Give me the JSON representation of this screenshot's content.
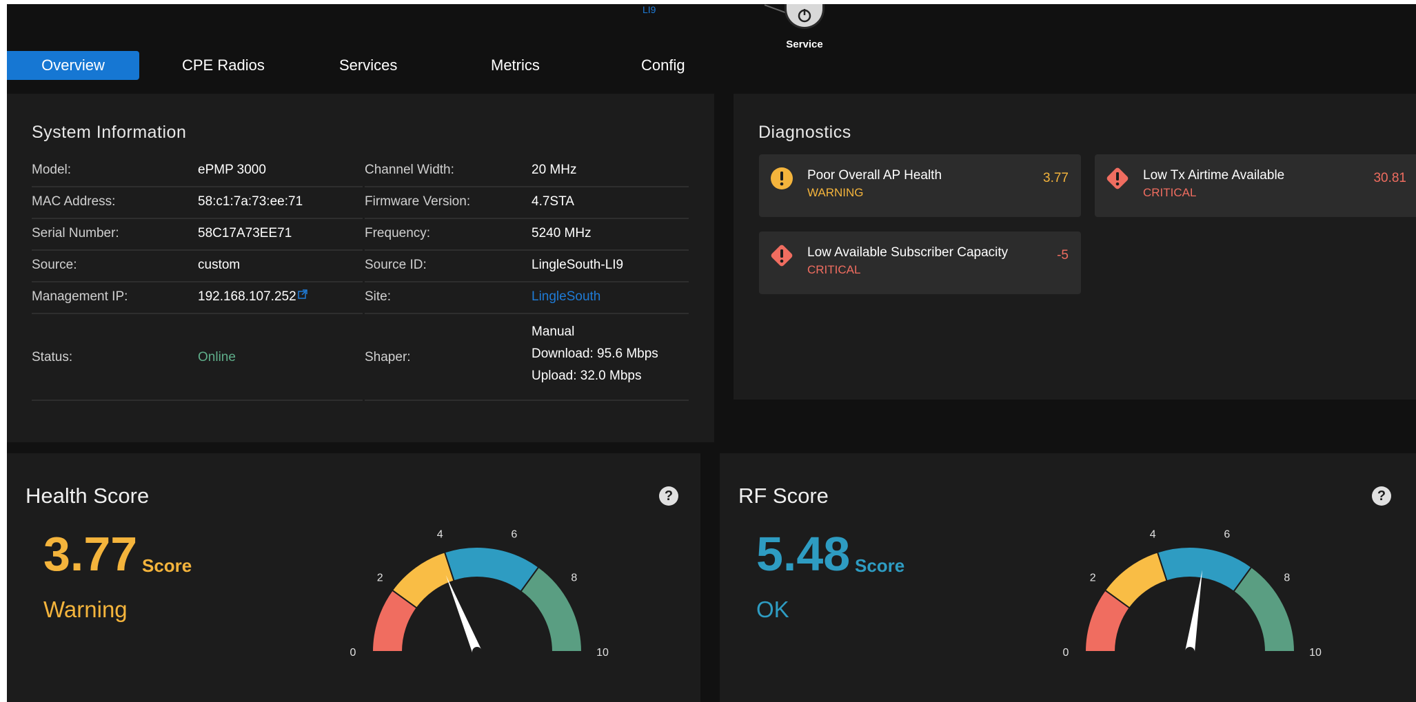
{
  "topology": {
    "link_label": "LI9",
    "node_label": "Service"
  },
  "tabs": [
    {
      "label": "Overview",
      "active": true
    },
    {
      "label": "CPE Radios"
    },
    {
      "label": "Services"
    },
    {
      "label": "Metrics"
    },
    {
      "label": "Config"
    }
  ],
  "system_info": {
    "title": "System Information",
    "left": [
      {
        "label": "Model:",
        "value": "ePMP 3000"
      },
      {
        "label": "MAC Address:",
        "value": "58:c1:7a:73:ee:71"
      },
      {
        "label": "Serial Number:",
        "value": "58C17A73EE71"
      },
      {
        "label": "Source:",
        "value": "custom"
      },
      {
        "label": "Management IP:",
        "value": "192.168.107.252"
      },
      {
        "label": "Status:",
        "value": "Online"
      }
    ],
    "right": [
      {
        "label": "Channel Width:",
        "value": "20 MHz"
      },
      {
        "label": "Firmware Version:",
        "value": "4.7STA"
      },
      {
        "label": "Frequency:",
        "value": "5240 MHz"
      },
      {
        "label": "Source ID:",
        "value": "LingleSouth-LI9"
      },
      {
        "label": "Site:",
        "value": "LingleSouth"
      },
      {
        "label": "Shaper:",
        "value_lines": [
          "Manual",
          "Download: 95.6 Mbps",
          "Upload: 32.0 Mbps"
        ]
      }
    ]
  },
  "diagnostics": {
    "title": "Diagnostics",
    "items": [
      {
        "title": "Poor Overall AP Health",
        "level": "WARNING",
        "value": "3.77",
        "icon": "warning-circle-icon"
      },
      {
        "title": "Low Tx Airtime Available",
        "level": "CRITICAL",
        "value": "30.81",
        "icon": "critical-diamond-icon"
      },
      {
        "title": "Low Available Subscriber Capacity",
        "level": "CRITICAL",
        "value": "-5",
        "icon": "critical-diamond-icon"
      }
    ]
  },
  "health_score": {
    "title": "Health Score",
    "score": "3.77",
    "score_value": 3.77,
    "unit": "Score",
    "status": "Warning",
    "color": "#f4b43c",
    "ticks": [
      "0",
      "2",
      "4",
      "6",
      "8",
      "10"
    ]
  },
  "rf_score": {
    "title": "RF Score",
    "score": "5.48",
    "score_value": 5.48,
    "unit": "Score",
    "status": "OK",
    "color": "#2e9cc2",
    "ticks": [
      "0",
      "2",
      "4",
      "6",
      "8",
      "10"
    ]
  },
  "gauge_colors": {
    "red": "#f06d60",
    "yellow": "#f9bd45",
    "blue": "#2e9cc2",
    "green": "#5a9e82"
  }
}
